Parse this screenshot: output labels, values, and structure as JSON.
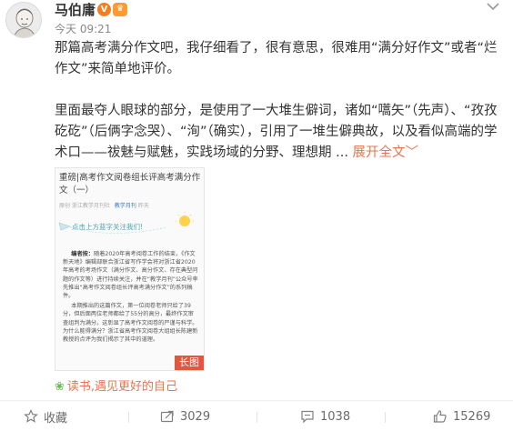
{
  "header": {
    "author": "马伯庸",
    "verified_badge": "V",
    "level_badge": "♛",
    "time": "今天 09:21",
    "more_icon": "chevron-down-icon"
  },
  "content": {
    "para1": "那篇高考满分作文吧，我仔细看了，很有意思，很难用“满分好作文”或者“烂作文”来简单地评价。",
    "para2": "里面最夺人眼球的部分，是使用了一大堆生僻词，诸如“嚆矢”（先声）、“孜孜矻矻”（后俩字念哭）、“洵”（确实），引用了一堆生僻典故，以及看似高端的学术口——祓魅与赋魅，实践场域的分野、理想期 ...",
    "expand_label": "展开全文",
    "expand_arrow": "﹀"
  },
  "image": {
    "title": "重磅|高考作文阅卷组长评高考满分作文（一）",
    "meta_source": "原创",
    "meta_org": "浙江教学月刊社",
    "meta_account": "教学月刊",
    "meta_edit": "昨天",
    "follow_text": "点击上方蓝字关注我们!",
    "body_p1_label": "编者按：",
    "body_p1": "随着2020年高考阅卷工作的结束，《作文新天地》编辑部联合浙江省写作学会将对浙江省2020年高考的考场作文（满分作文、高分作文、存在典型问题的作文等）进行持续关注，并在“教学月刊”公众号率先推出“高考作文阅卷组长评高考满分作文”的系列稿件。",
    "body_p2": "本期推出的这篇作文，第一位阅卷老师只给了39分，但后面两位老师都给了55分的高分，最终作文审查组判为满分。这彰显了高考作文阅卷的严谨与科学。为什么能得满分？浙江省高考作文阅卷大组组长陈建新教授的点评为我们揭示了其中的道理。",
    "long_image_label": "长图"
  },
  "source": {
    "icon": "leaf-icon",
    "label": "读书,遇见更好的自己"
  },
  "actions": {
    "favorite_label": "收藏",
    "repost_count": "3029",
    "comment_count": "1038",
    "like_count": "15269"
  },
  "colors": {
    "accent": "#eb7350",
    "verified": "#f57c1f",
    "link_blue": "#3a7bbf"
  }
}
